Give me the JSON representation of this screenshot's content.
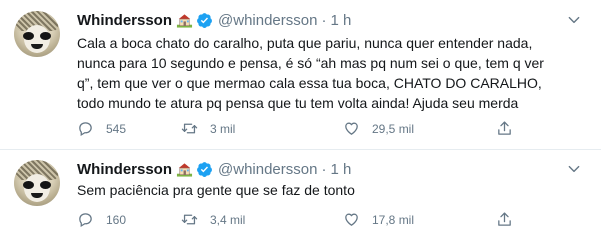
{
  "tweets": [
    {
      "name": "Whindersson",
      "name_emoji": "house-with-garden-icon",
      "verified": true,
      "handle": "@whindersson",
      "separator": "·",
      "time": "1 h",
      "text_lines": [
        "Cala a boca chato do caralho, puta que pariu, nunca quer entender nada,",
        "nunca para 10 segundo e pensa, é só “ah mas pq num sei o que, tem q ver",
        "q”, tem que ver o que mermao cala essa tua boca, CHATO DO CARALHO,",
        "todo mundo te atura pq pensa que tu tem volta ainda! Ajuda seu merda"
      ],
      "replies": "545",
      "retweets": "3 mil",
      "likes": "29,5 mil"
    },
    {
      "name": "Whindersson",
      "name_emoji": "house-with-garden-icon",
      "verified": true,
      "handle": "@whindersson",
      "separator": "·",
      "time": "1 h",
      "text_lines": [
        "Sem paciência pra gente que se faz de tonto"
      ],
      "replies": "160",
      "retweets": "3,4 mil",
      "likes": "17,8 mil"
    }
  ],
  "colors": {
    "text": "#14171a",
    "secondary": "#657786",
    "verified": "#1da1f2",
    "divider": "#e6ecf0"
  }
}
